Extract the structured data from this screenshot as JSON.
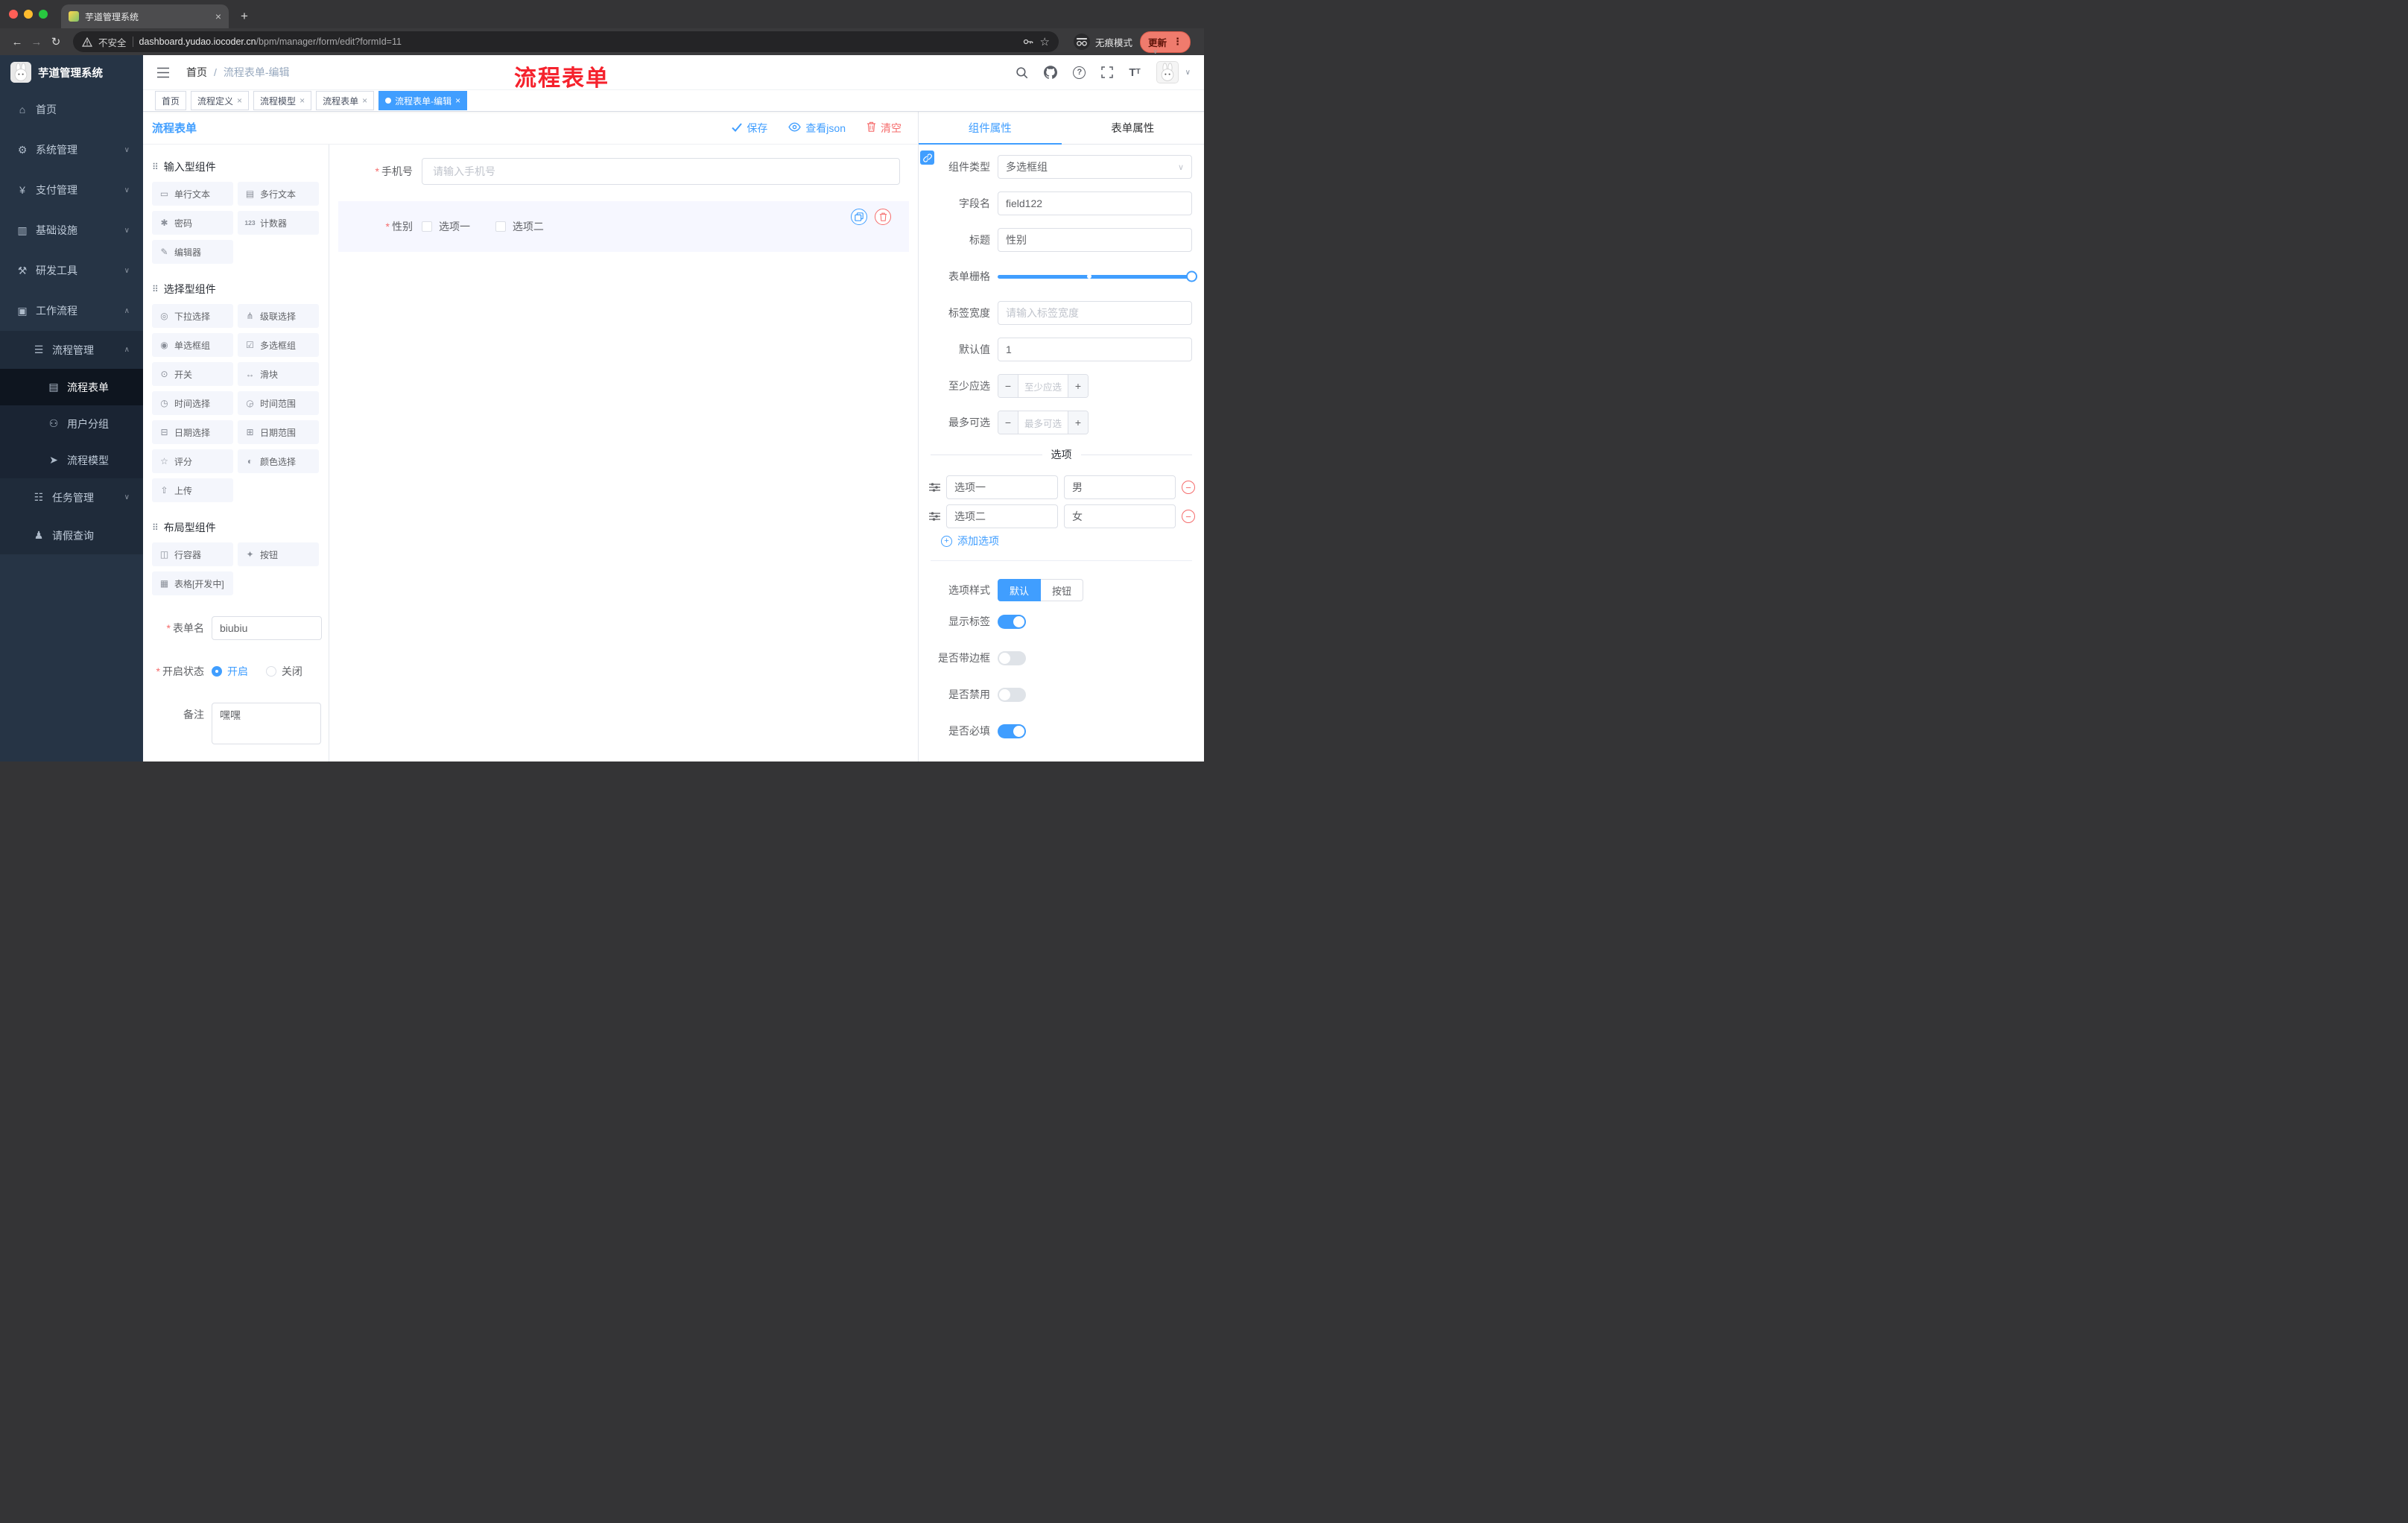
{
  "colors": {
    "accent": "#409eff",
    "danger": "#f56c6c",
    "annotation_red": "#f5222d",
    "sidebar_bg": "#263445"
  },
  "browser": {
    "tab_title": "芋道管理系统",
    "security_label": "不安全",
    "url_host": "dashboard.yudao.iocoder.cn",
    "url_path": "/bpm/manager/form/edit?formId=11",
    "incognito_label": "无痕模式",
    "update_label": "更新",
    "icons": [
      "back-icon",
      "forward-icon",
      "reload-icon",
      "warning-icon",
      "key-icon",
      "star-icon",
      "incognito-icon",
      "more-dots-icon"
    ]
  },
  "sidebar": {
    "logo_title": "芋道管理系统",
    "items": [
      {
        "label": "首页",
        "icon": "home-icon"
      },
      {
        "label": "系统管理",
        "icon": "gear-icon"
      },
      {
        "label": "支付管理",
        "icon": "payment-icon"
      },
      {
        "label": "基础设施",
        "icon": "infrastructure-icon"
      },
      {
        "label": "研发工具",
        "icon": "devtools-icon"
      },
      {
        "label": "工作流程",
        "icon": "workflow-icon"
      },
      {
        "label": "流程管理",
        "icon": "process-manage-icon"
      },
      {
        "label": "流程表单",
        "icon": "process-form-icon"
      },
      {
        "label": "用户分组",
        "icon": "user-group-icon"
      },
      {
        "label": "流程模型",
        "icon": "process-model-icon"
      },
      {
        "label": "任务管理",
        "icon": "task-manage-icon"
      },
      {
        "label": "请假查询",
        "icon": "leave-query-icon"
      }
    ]
  },
  "header": {
    "breadcrumb_home": "首页",
    "breadcrumb_current": "流程表单-编辑",
    "annotation": "流程表单",
    "icons": [
      "search-icon",
      "github-icon",
      "help-icon",
      "fullscreen-icon",
      "font-size-icon",
      "avatar",
      "caret-down-icon"
    ]
  },
  "tags": {
    "items": [
      {
        "label": "首页"
      },
      {
        "label": "流程定义"
      },
      {
        "label": "流程模型"
      },
      {
        "label": "流程表单"
      },
      {
        "label": "流程表单-编辑"
      }
    ]
  },
  "designer": {
    "title": "流程表单",
    "actions": {
      "save": {
        "label": "保存",
        "icon": "check-icon"
      },
      "view_json": {
        "label": "查看json",
        "icon": "eye-icon"
      },
      "clear": {
        "label": "清空",
        "icon": "trash-icon"
      }
    },
    "groups": [
      {
        "title": "输入型组件",
        "items": [
          {
            "label": "单行文本",
            "icon": "text-field-icon"
          },
          {
            "label": "多行文本",
            "icon": "textarea-icon"
          },
          {
            "label": "密码",
            "icon": "password-icon"
          },
          {
            "label": "计数器",
            "icon": "counter-icon"
          },
          {
            "label": "编辑器",
            "icon": "rich-editor-icon"
          }
        ]
      },
      {
        "title": "选择型组件",
        "items": [
          {
            "label": "下拉选择",
            "icon": "select-icon"
          },
          {
            "label": "级联选择",
            "icon": "cascader-icon"
          },
          {
            "label": "单选框组",
            "icon": "radio-group-icon"
          },
          {
            "label": "多选框组",
            "icon": "checkbox-group-icon"
          },
          {
            "label": "开关",
            "icon": "switch-icon"
          },
          {
            "label": "滑块",
            "icon": "slider-icon"
          },
          {
            "label": "时间选择",
            "icon": "time-picker-icon"
          },
          {
            "label": "时间范围",
            "icon": "time-range-icon"
          },
          {
            "label": "日期选择",
            "icon": "date-picker-icon"
          },
          {
            "label": "日期范围",
            "icon": "date-range-icon"
          },
          {
            "label": "评分",
            "icon": "rate-icon"
          },
          {
            "label": "颜色选择",
            "icon": "color-picker-icon"
          },
          {
            "label": "上传",
            "icon": "upload-icon"
          }
        ]
      },
      {
        "title": "布局型组件",
        "items": [
          {
            "label": "行容器",
            "icon": "row-container-icon"
          },
          {
            "label": "按钮",
            "icon": "button-icon"
          },
          {
            "label": "表格[开发中]",
            "icon": "table-icon"
          }
        ]
      }
    ],
    "form_meta": {
      "name_label": "表单名",
      "name_value": "biubiu",
      "status_label": "开启状态",
      "status_on": "开启",
      "status_off": "关闭",
      "remark_label": "备注",
      "remark_value": "嘿嘿"
    },
    "canvas": {
      "phone_label": "手机号",
      "phone_placeholder": "请输入手机号",
      "gender_label": "性别",
      "gender_options": [
        "选项一",
        "选项二"
      ]
    },
    "props": {
      "tab_component": "组件属性",
      "tab_form": "表单属性",
      "component_type_label": "组件类型",
      "component_type_value": "多选框组",
      "field_name_label": "字段名",
      "field_name_value": "field122",
      "title_label": "标题",
      "title_value": "性别",
      "grid_label": "表单栅格",
      "label_width_label": "标签宽度",
      "label_width_placeholder": "请输入标签宽度",
      "default_label": "默认值",
      "default_value": "1",
      "min_label": "至少应选",
      "min_placeholder": "至少应选",
      "max_label": "最多可选",
      "max_placeholder": "最多可选",
      "options_divider": "选项",
      "options": [
        {
          "label": "选项一",
          "value": "男"
        },
        {
          "label": "选项二",
          "value": "女"
        }
      ],
      "add_option": "添加选项",
      "style_label": "选项样式",
      "style_default": "默认",
      "style_button": "按钮",
      "show_label": "显示标签",
      "border_label": "是否带边框",
      "disabled_label": "是否禁用",
      "required_label": "是否必填"
    }
  }
}
